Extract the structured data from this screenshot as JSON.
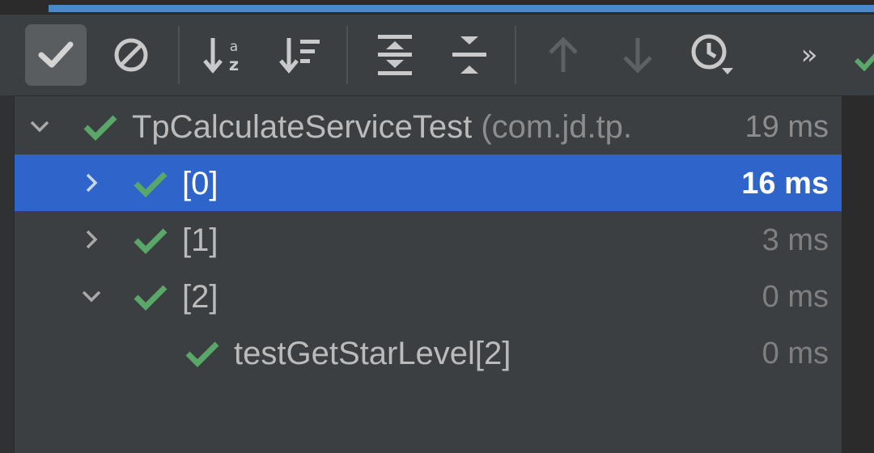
{
  "toolbar": {
    "buttons": [
      {
        "name": "show-passed",
        "icon": "check-icon",
        "active": true
      },
      {
        "name": "show-ignored",
        "icon": "ignore-icon"
      },
      {
        "name": "sort-alphabetically",
        "icon": "sort-alpha-icon"
      },
      {
        "name": "sort-by-duration",
        "icon": "sort-duration-icon"
      },
      {
        "name": "expand-all",
        "icon": "expand-all-icon"
      },
      {
        "name": "collapse-all",
        "icon": "collapse-all-icon"
      },
      {
        "name": "previous-failed",
        "icon": "arrow-up-icon"
      },
      {
        "name": "next-failed",
        "icon": "arrow-down-icon"
      },
      {
        "name": "test-history",
        "icon": "clock-icon"
      },
      {
        "name": "more",
        "icon": "chevron-double-right-icon",
        "label": "»"
      }
    ],
    "accent_color": "#4a88c7",
    "pass_color": "#59a869"
  },
  "tree": {
    "rows": [
      {
        "label": "TpCalculateServiceTest",
        "package": "(com.jd.tp.",
        "time": "19 ms",
        "expanded": true,
        "status": "passed"
      },
      {
        "label": "[0]",
        "time": "16 ms",
        "expanded": false,
        "selected": true,
        "status": "passed"
      },
      {
        "label": "[1]",
        "time": "3 ms",
        "expanded": false,
        "status": "passed"
      },
      {
        "label": "[2]",
        "time": "0 ms",
        "expanded": true,
        "status": "passed"
      },
      {
        "label": "testGetStarLevel[2]",
        "time": "0 ms",
        "status": "passed"
      }
    ],
    "selection_color": "#2f65ca"
  }
}
